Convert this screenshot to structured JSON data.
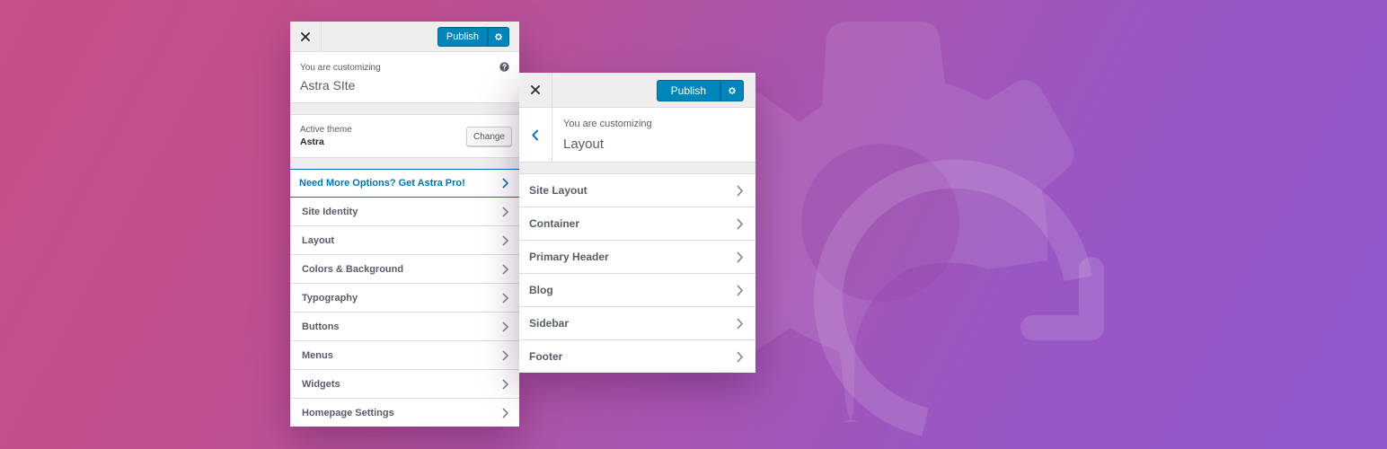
{
  "left_panel": {
    "close_icon": "close-icon",
    "publish_label": "Publish",
    "settings_icon": "gear-icon",
    "customizing_label": "You are customizing",
    "site_title": "Astra SIte",
    "help_icon": "help-icon",
    "active_theme_label": "Active theme",
    "active_theme_name": "Astra",
    "change_label": "Change",
    "promo_label": "Need More Options? Get Astra Pro!",
    "items": [
      {
        "label": "Site Identity"
      },
      {
        "label": "Layout"
      },
      {
        "label": "Colors & Background"
      },
      {
        "label": "Typography"
      },
      {
        "label": "Buttons"
      },
      {
        "label": "Menus"
      },
      {
        "label": "Widgets"
      },
      {
        "label": "Homepage Settings"
      }
    ]
  },
  "right_panel": {
    "close_icon": "close-icon",
    "publish_label": "Publish",
    "settings_icon": "gear-icon",
    "back_icon": "chevron-left-icon",
    "customizing_label": "You are customizing",
    "section_title": "Layout",
    "items": [
      {
        "label": "Site Layout"
      },
      {
        "label": "Container"
      },
      {
        "label": "Primary Header"
      },
      {
        "label": "Blog"
      },
      {
        "label": "Sidebar"
      },
      {
        "label": "Footer"
      }
    ]
  },
  "colors": {
    "accent": "#0085ba",
    "link": "#0073aa",
    "text": "#555d66",
    "bg_gradient_start": "#c84f88",
    "bg_gradient_end": "#9158cc"
  },
  "background_icon": "customize-gear-refresh-icon"
}
